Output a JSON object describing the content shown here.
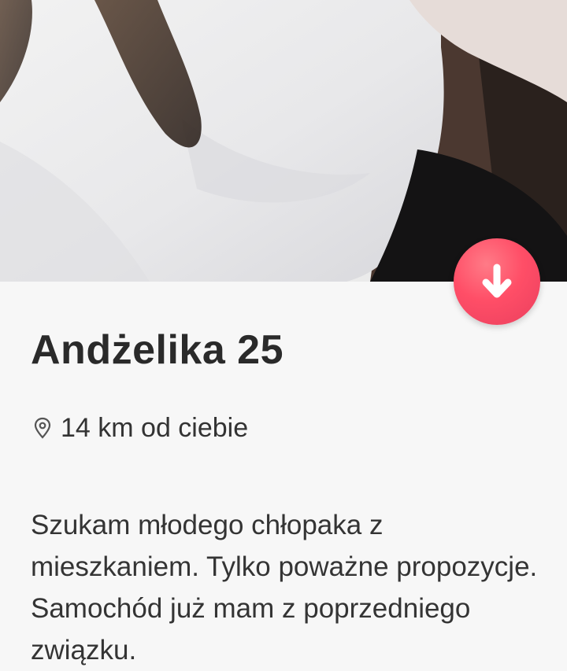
{
  "profile": {
    "name_age": "Andżelika 25",
    "distance": "14 km od ciebie",
    "bio": "Szukam młodego chłopaka z mieszkaniem. Tylko poważne propozycje. Samochód już mam z poprzedniego związku."
  },
  "actions": {
    "collapse_icon": "arrow-down-icon",
    "collapse_color": "#ff4e67"
  },
  "icons": {
    "location": "location-pin-icon"
  },
  "colors": {
    "background": "#f7f7f7",
    "text": "#2a2a2a"
  }
}
